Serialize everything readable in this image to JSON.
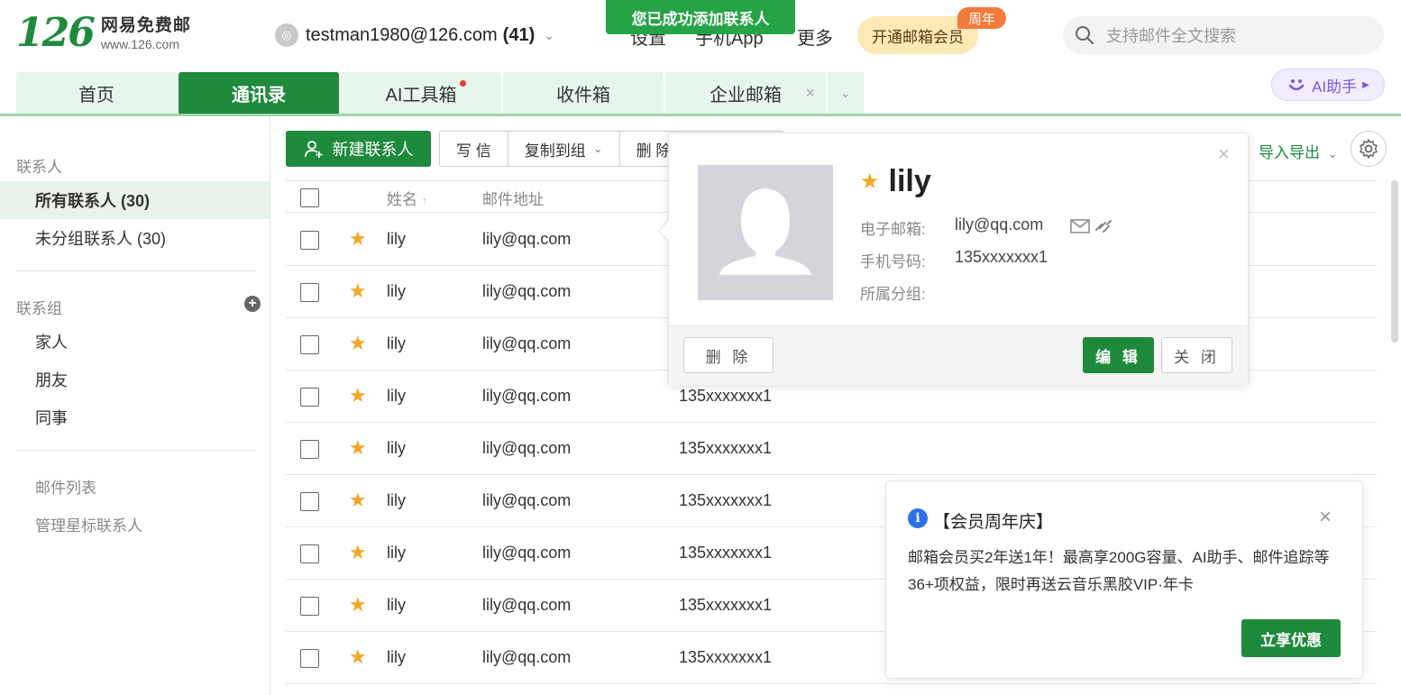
{
  "logo": {
    "mark": "126",
    "name": "网易免费邮",
    "url": "www.126.com"
  },
  "account": {
    "email": "testman1980@126.com",
    "count": "(41)"
  },
  "toast": "您已成功添加联系人",
  "topnav": {
    "settings": "设置",
    "app": "手机App",
    "more": "更多"
  },
  "vip": {
    "label": "开通邮箱会员",
    "badge": "周年"
  },
  "search": {
    "placeholder": "支持邮件全文搜索"
  },
  "tabs": [
    {
      "label": "首页"
    },
    {
      "label": "通讯录"
    },
    {
      "label": "AI工具箱"
    },
    {
      "label": "收件箱"
    },
    {
      "label": "企业邮箱"
    }
  ],
  "ai_button": "AI助手",
  "sidebar": {
    "contacts_header": "联系人",
    "all_contacts": "所有联系人 (30)",
    "ungrouped": "未分组联系人 (30)",
    "groups_header": "联系组",
    "groups": [
      "家人",
      "朋友",
      "同事"
    ],
    "mail_list": "邮件列表",
    "manage_starred": "管理星标联系人"
  },
  "toolbar": {
    "new_contact": "新建联系人",
    "write": "写 信",
    "copy_to_group": "复制到组",
    "delete": "删 除",
    "import_export": "导入导出"
  },
  "table": {
    "headers": {
      "name": "姓名",
      "email": "邮件地址"
    },
    "rows": [
      {
        "name": "lily",
        "email": "lily@qq.com",
        "phone": ""
      },
      {
        "name": "lily",
        "email": "lily@qq.com",
        "phone": ""
      },
      {
        "name": "lily",
        "email": "lily@qq.com",
        "phone": ""
      },
      {
        "name": "lily",
        "email": "lily@qq.com",
        "phone": "135xxxxxxx1"
      },
      {
        "name": "lily",
        "email": "lily@qq.com",
        "phone": "135xxxxxxx1"
      },
      {
        "name": "lily",
        "email": "lily@qq.com",
        "phone": "135xxxxxxx1"
      },
      {
        "name": "lily",
        "email": "lily@qq.com",
        "phone": "135xxxxxxx1"
      },
      {
        "name": "lily",
        "email": "lily@qq.com",
        "phone": "135xxxxxxx1"
      },
      {
        "name": "lily",
        "email": "lily@qq.com",
        "phone": "135xxxxxxx1"
      }
    ]
  },
  "popup": {
    "name": "lily",
    "email_label": "电子邮箱:",
    "email": "lily@qq.com",
    "phone_label": "手机号码:",
    "phone": "135xxxxxxx1",
    "group_label": "所属分组:",
    "delete": "删 除",
    "edit": "编 辑",
    "close": "关 闭"
  },
  "promo": {
    "title": "【会员周年庆】",
    "body": "邮箱会员买2年送1年！最高享200G容量、AI助手、邮件追踪等36+项权益，限时再送云音乐黑胶VIP·年卡",
    "button": "立享优惠"
  },
  "colors": {
    "brand_green": "#1e8a3c",
    "star": "#f5a623",
    "toast_green": "#27a347"
  }
}
